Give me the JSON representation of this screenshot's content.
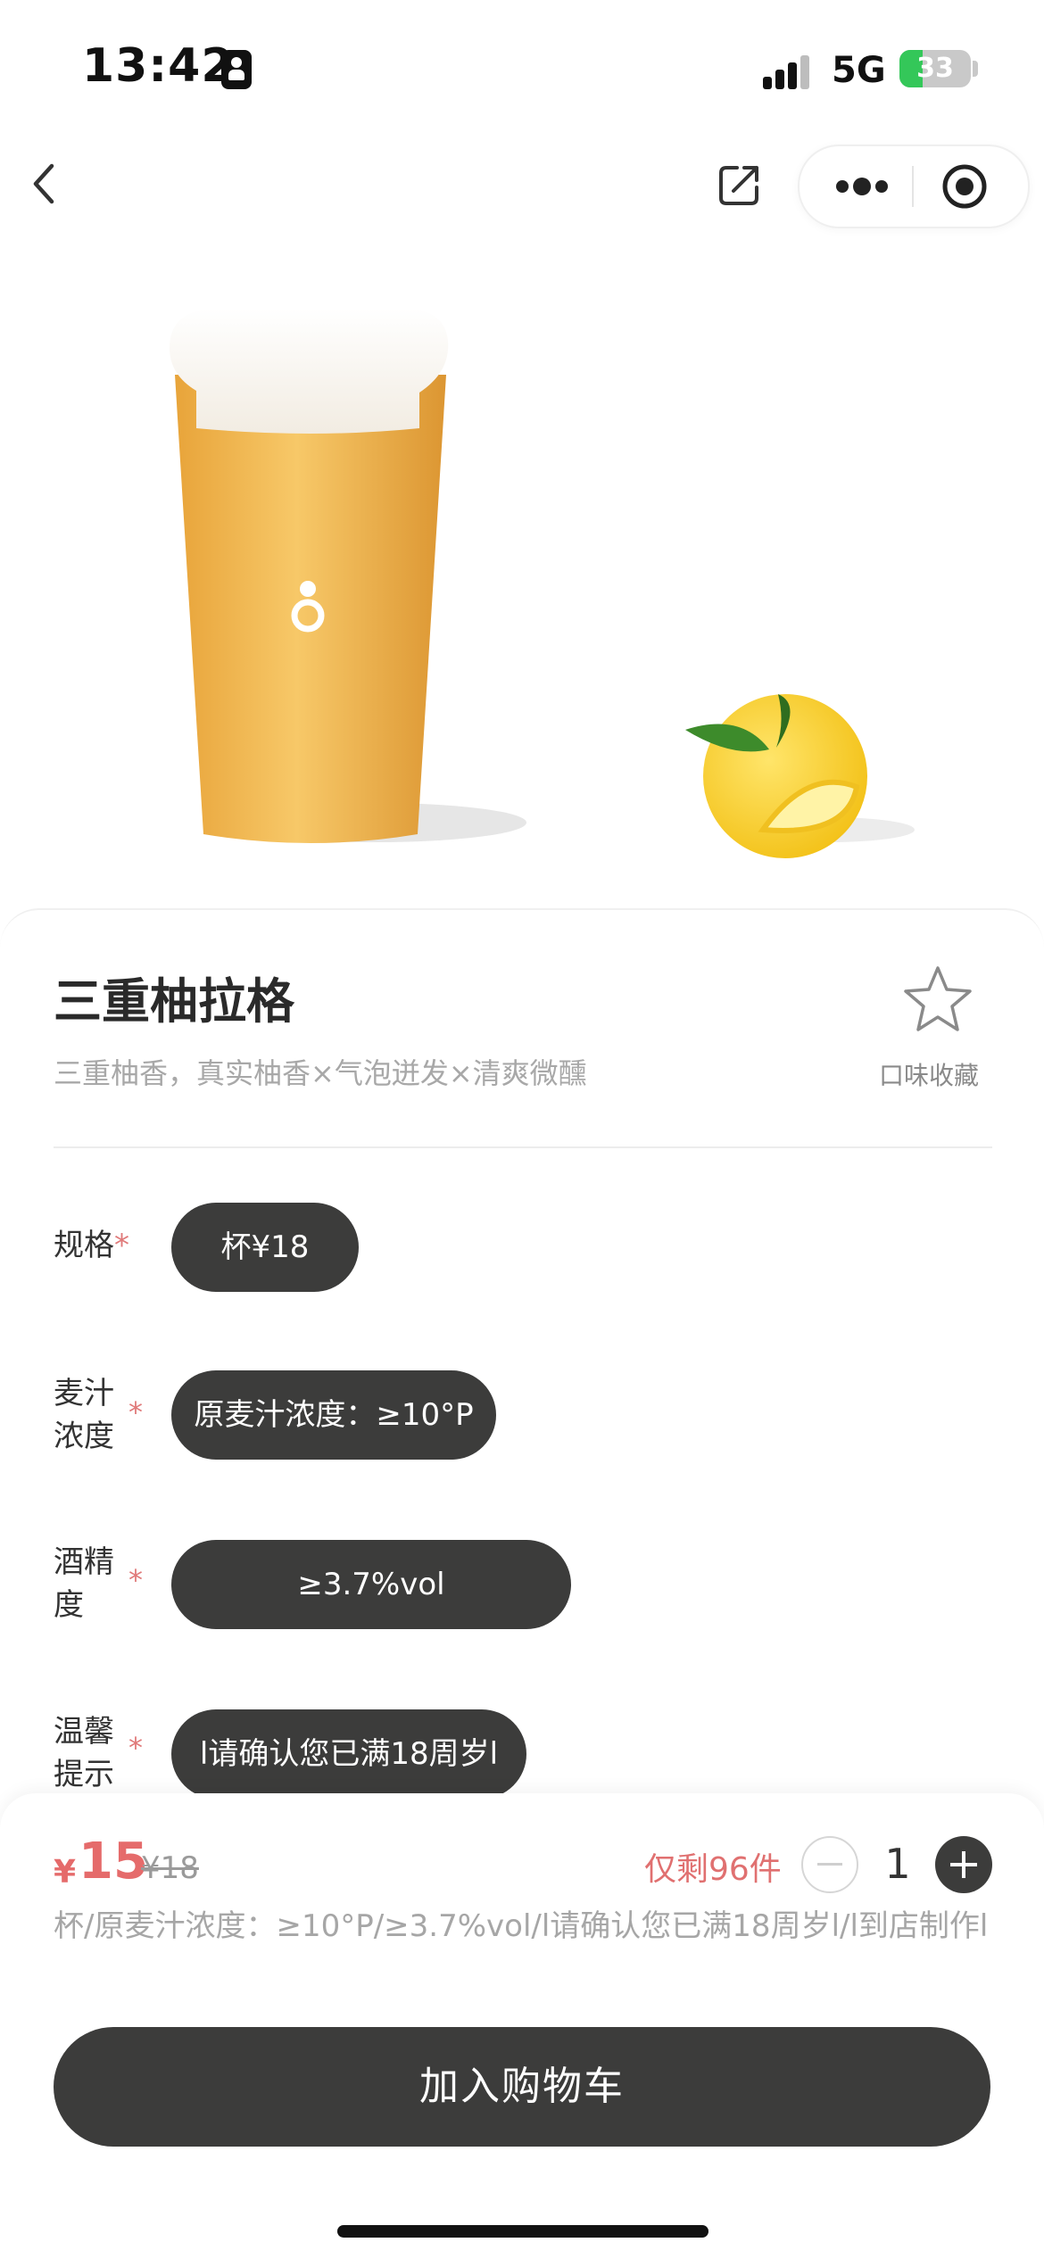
{
  "status": {
    "time": "13:42",
    "network": "5G",
    "battery": "33",
    "battery_fraction": 0.33
  },
  "product": {
    "title": "三重柚拉格",
    "subtitle": "三重柚香，真实柚香×气泡迸发×清爽微醺",
    "favorite_label": "口味收藏"
  },
  "options": [
    {
      "label_line1": "规格",
      "label_line2": "",
      "value": "杯¥18"
    },
    {
      "label_line1": "麦汁",
      "label_line2": "浓度",
      "value": "原麦汁浓度：≥10°P"
    },
    {
      "label_line1": "酒精",
      "label_line2": "度",
      "value": "≥3.7%vol"
    },
    {
      "label_line1": "温馨",
      "label_line2": "提示",
      "value": "l请确认您已满18周岁l"
    }
  ],
  "required_mark": "*",
  "footer": {
    "currency": "¥",
    "price": "15",
    "original_price": "¥18",
    "stock": "仅剩96件",
    "quantity": "1",
    "summary": "杯/原麦汁浓度：≥10°P/≥3.7%vol/l请确认您已满18周岁l/l到店制作l",
    "add_to_cart": "加入购物车"
  },
  "colors": {
    "accent_red": "#e56b6b",
    "chip_dark": "#3c3c3b",
    "battery_green": "#34c759"
  }
}
